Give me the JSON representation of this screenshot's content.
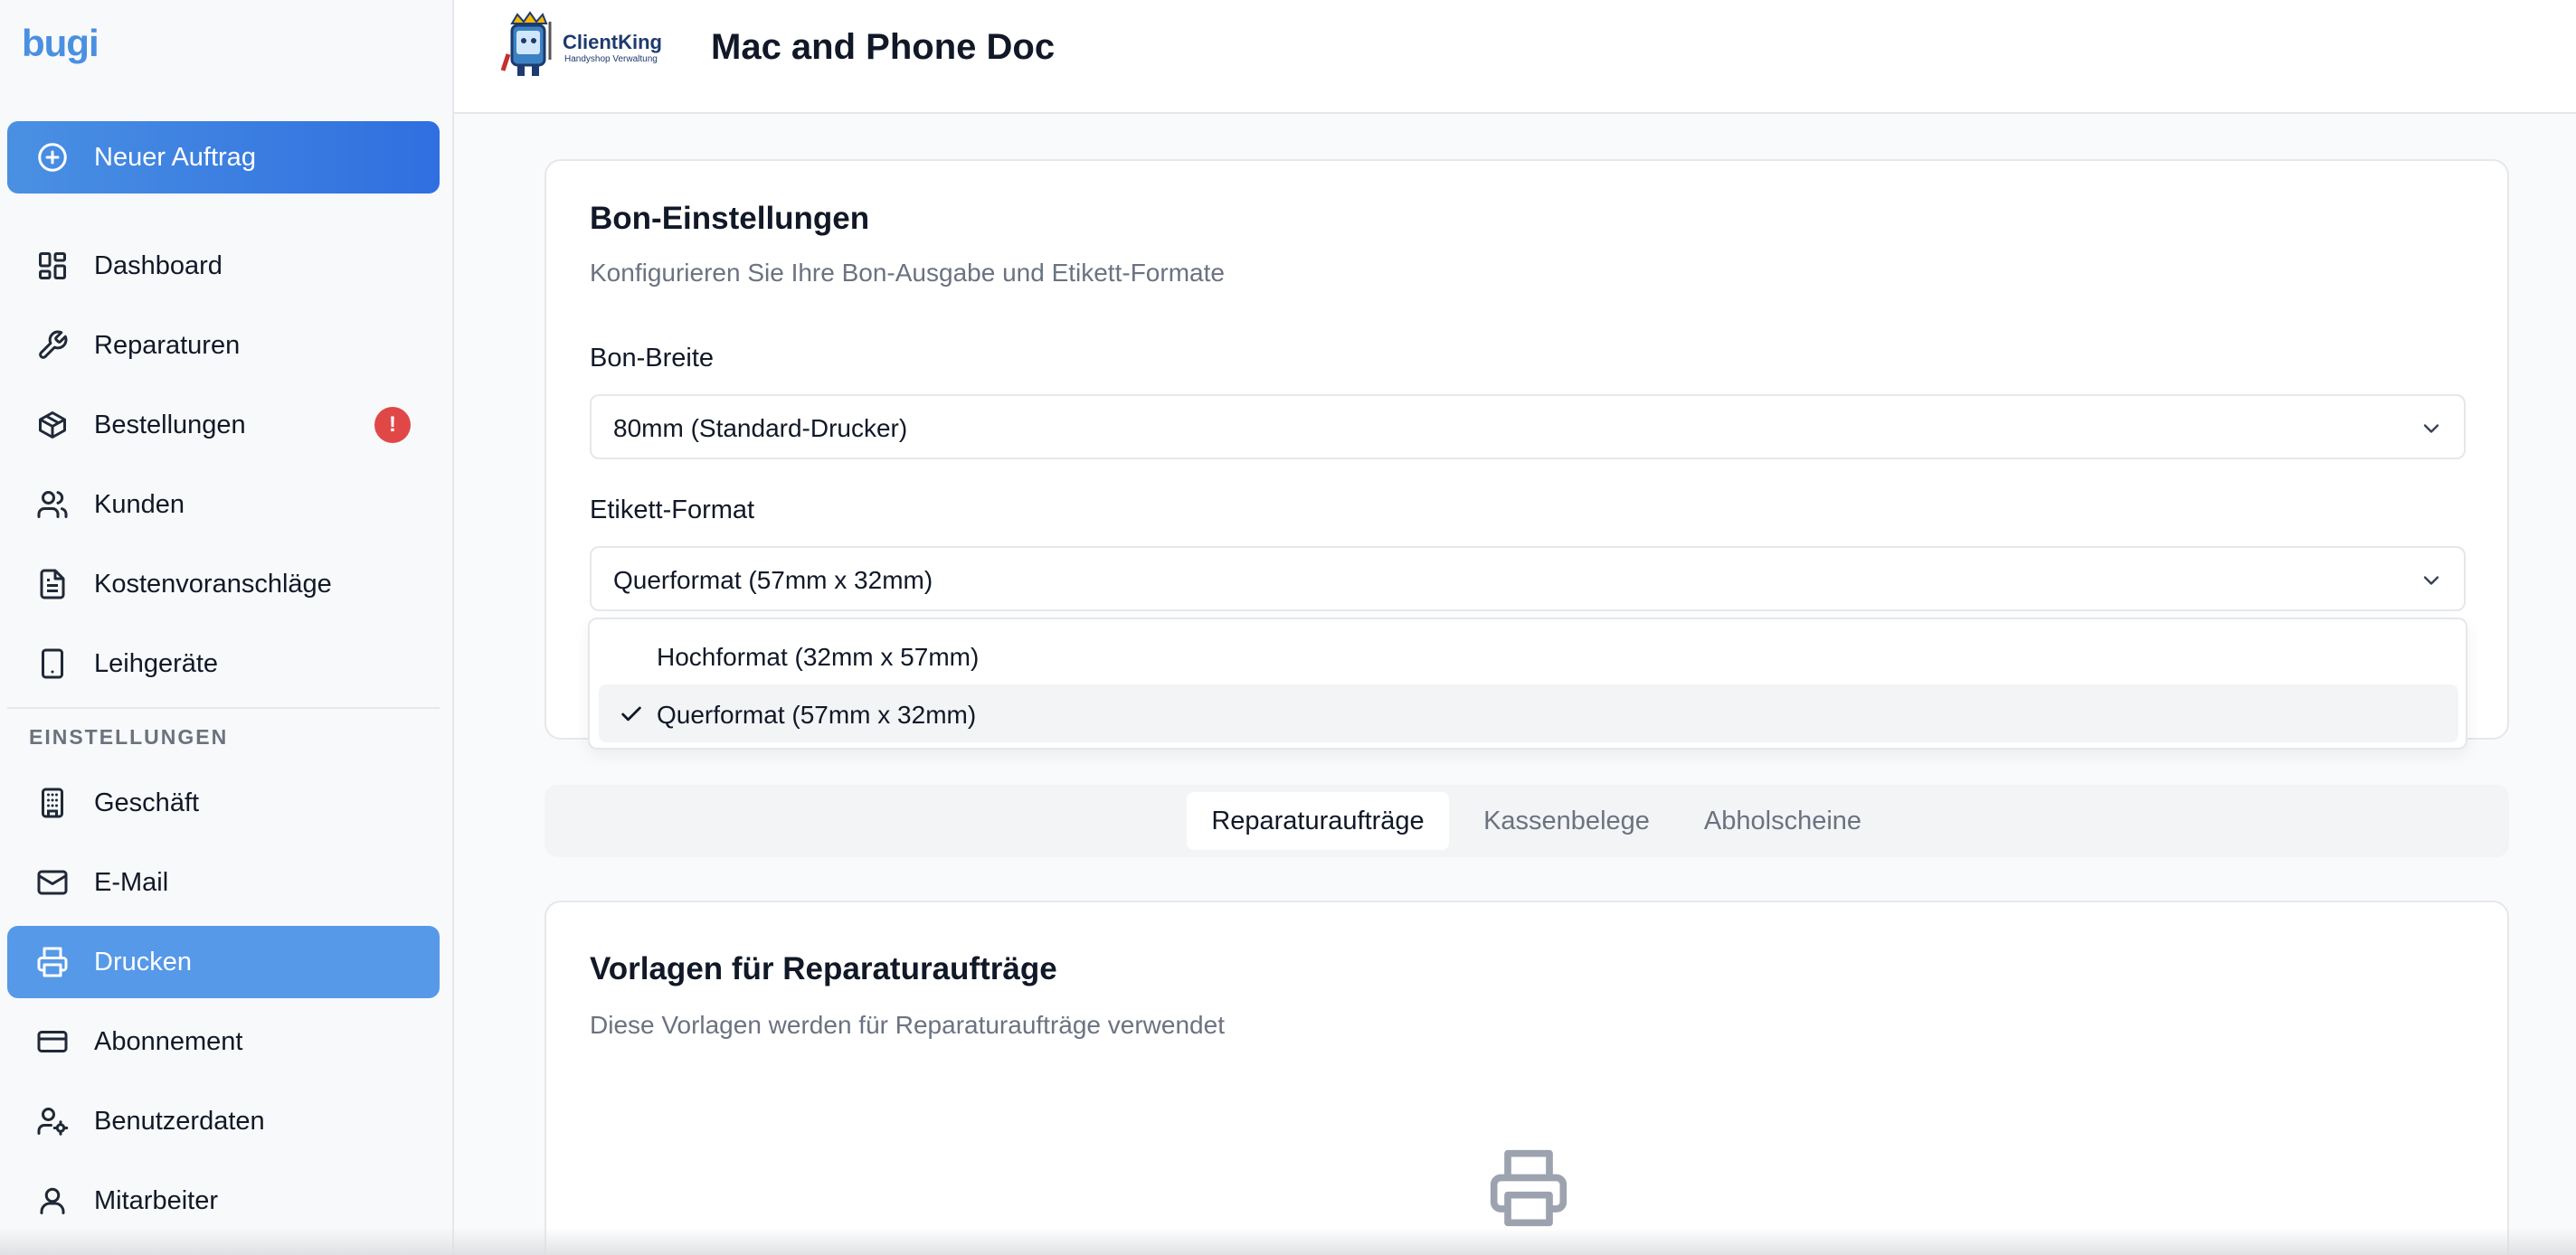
{
  "sidebar": {
    "brand": "bugi",
    "new_order_label": "Neuer Auftrag",
    "items": [
      {
        "label": "Dashboard",
        "icon": "dashboard-icon"
      },
      {
        "label": "Reparaturen",
        "icon": "wrench-icon"
      },
      {
        "label": "Bestellungen",
        "icon": "package-icon",
        "badge": "!"
      },
      {
        "label": "Kunden",
        "icon": "users-icon"
      },
      {
        "label": "Kostenvoranschläge",
        "icon": "document-icon"
      },
      {
        "label": "Leihgeräte",
        "icon": "tablet-icon"
      }
    ],
    "settings_title": "EINSTELLUNGEN",
    "settings_items": [
      {
        "label": "Geschäft",
        "icon": "building-icon"
      },
      {
        "label": "E-Mail",
        "icon": "mail-icon"
      },
      {
        "label": "Drucken",
        "icon": "printer-icon",
        "active": true
      },
      {
        "label": "Abonnement",
        "icon": "credit-card-icon"
      },
      {
        "label": "Benutzerdaten",
        "icon": "user-cog-icon"
      },
      {
        "label": "Mitarbeiter",
        "icon": "user-icon"
      }
    ]
  },
  "header": {
    "logo_text": "ClientKing",
    "logo_subtext": "Handyshop Verwaltung",
    "title": "Mac and Phone Doc"
  },
  "receipt_settings": {
    "title": "Bon-Einstellungen",
    "description": "Konfigurieren Sie Ihre Bon-Ausgabe und Etikett-Formate",
    "width_label": "Bon-Breite",
    "width_value": "80mm (Standard-Drucker)",
    "label_format_label": "Etikett-Format",
    "label_format_value": "Querformat (57mm x 32mm)",
    "label_format_options": [
      {
        "label": "Hochformat (32mm x 57mm)",
        "selected": false
      },
      {
        "label": "Querformat (57mm x 32mm)",
        "selected": true
      }
    ]
  },
  "tabs": [
    {
      "label": "Reparaturaufträge",
      "active": true
    },
    {
      "label": "Kassenbelege",
      "active": false
    },
    {
      "label": "Abholscheine",
      "active": false
    }
  ],
  "templates": {
    "title": "Vorlagen für Reparaturaufträge",
    "description": "Diese Vorlagen werden für Reparaturaufträge verwendet",
    "empty_icon": "printer-icon"
  },
  "colors": {
    "brand": "#4a90e2",
    "active_nav": "#5599e8",
    "badge": "#e04848"
  }
}
